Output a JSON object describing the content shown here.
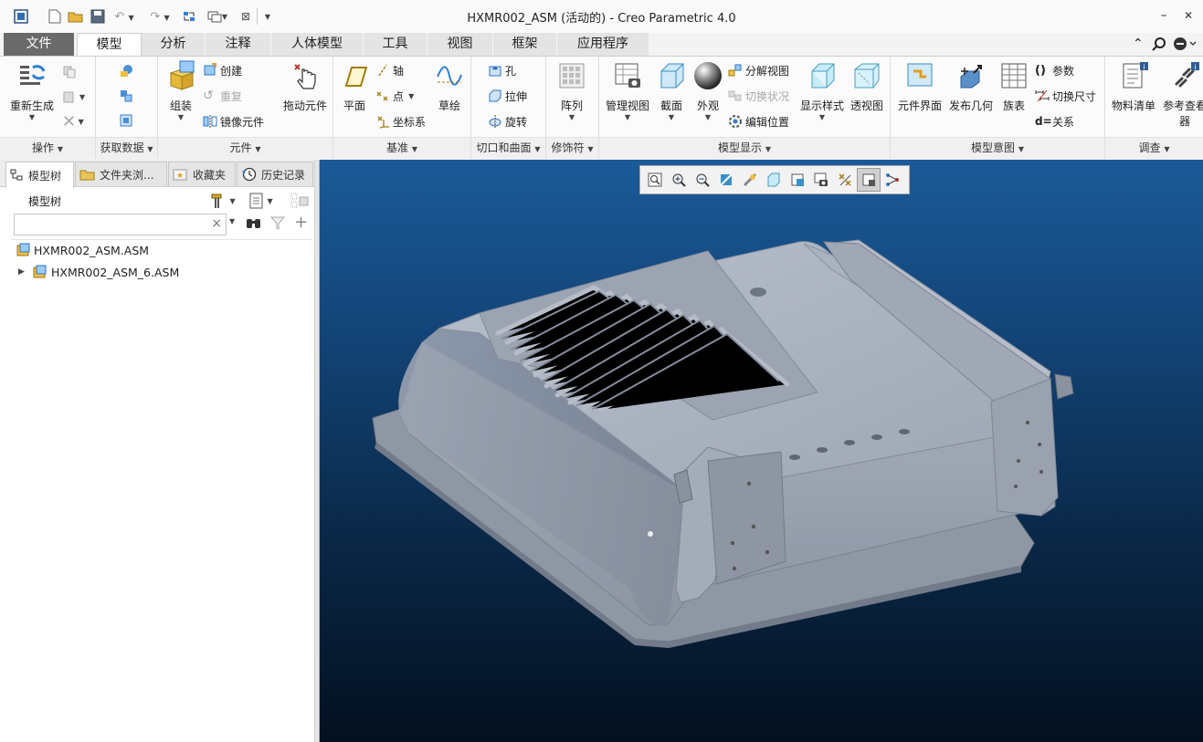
{
  "window": {
    "title": "HXMR002_ASM (活动的) - Creo Parametric 4.0",
    "minimize": "–",
    "close": "✕"
  },
  "tabs": [
    {
      "label": "文件"
    },
    {
      "label": "模型"
    },
    {
      "label": "分析"
    },
    {
      "label": "注释"
    },
    {
      "label": "人体模型"
    },
    {
      "label": "工具"
    },
    {
      "label": "视图"
    },
    {
      "label": "框架"
    },
    {
      "label": "应用程序"
    }
  ],
  "ribbon": {
    "operations": {
      "regen": "重新生成",
      "label": "操作"
    },
    "get_data": {
      "label": "获取数据"
    },
    "components": {
      "assemble": "组装",
      "create": "创建",
      "repeat": "重复",
      "mirror": "镜像元件",
      "drag": "拖动元件",
      "label": "元件"
    },
    "datum": {
      "plane": "平面",
      "axis": "轴",
      "point": "点",
      "csys": "坐标系",
      "sketch": "草绘",
      "label": "基准"
    },
    "cut_surface": {
      "hole": "孔",
      "extrude": "拉伸",
      "revolve": "旋转",
      "label": "切口和曲面"
    },
    "modifiers": {
      "pattern": "阵列",
      "label": "修饰符"
    },
    "model_display": {
      "manage_views": "管理视图",
      "section": "截面",
      "appearance": "外观",
      "explode": "分解视图",
      "toggle_state": "切换状况",
      "edit_position": "编辑位置",
      "display_style": "显示样式",
      "perspective": "透视图",
      "label": "模型显示"
    },
    "model_intent": {
      "comp_interface": "元件界面",
      "publish_geom": "发布几何",
      "family_table": "族表",
      "params": "参数",
      "switch_dims": "切换尺寸",
      "relations": "关系",
      "label": "模型意图"
    },
    "investigate": {
      "bom": "物料清单",
      "ref_viewer_1": "参考查看",
      "ref_viewer_2": "器",
      "label": "调查"
    }
  },
  "panel": {
    "tabs": [
      {
        "label": "模型树"
      },
      {
        "label": "文件夹浏..."
      },
      {
        "label": "收藏夹"
      },
      {
        "label": "历史记录"
      }
    ],
    "tree_title": "模型树",
    "search_value": "",
    "search_clear": "×",
    "tree": [
      {
        "label": "HXMR002_ASM.ASM"
      },
      {
        "label": "HXMR002_ASM_6.ASM"
      }
    ]
  },
  "colors": {
    "accent": "#6a6a6a",
    "viewport_top": "#1b5a98",
    "viewport_bottom": "#03101f",
    "model_body": "#a3aab8"
  },
  "icons": [
    "refresh-icon",
    "search-icon",
    "help-icon",
    "zoom-icon",
    "saved-view-icon",
    "display-style-icon"
  ]
}
